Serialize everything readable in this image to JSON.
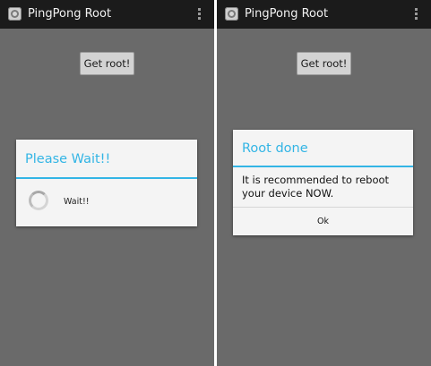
{
  "screens": [
    {
      "app_title": "PingPong Root",
      "get_root_label": "Get root!",
      "dialog": {
        "title": "Please Wait!!",
        "message": "Wait!!"
      }
    },
    {
      "app_title": "PingPong Root",
      "get_root_label": "Get root!",
      "dialog": {
        "title": "Root done",
        "message": "It is recommended to reboot your device NOW.",
        "ok_label": "Ok"
      }
    }
  ],
  "colors": {
    "accent": "#33b5e5",
    "background": "#6a6a6a",
    "action_bar": "#1b1b1b"
  },
  "icons": [
    "app-icon",
    "overflow-menu-icon",
    "progress-spinner-icon"
  ]
}
